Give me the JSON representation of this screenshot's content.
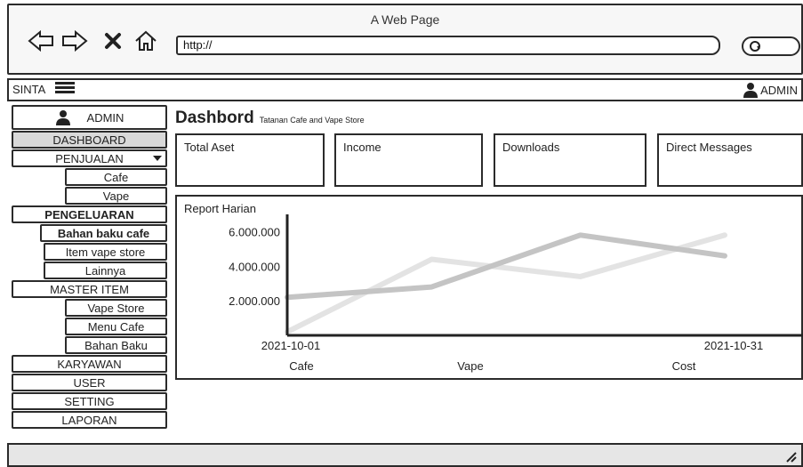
{
  "window": {
    "title": "A Web Page"
  },
  "browser": {
    "url": "http://"
  },
  "app_bar": {
    "brand": "SINTA",
    "user": "ADMIN"
  },
  "sidebar": {
    "user": "ADMIN",
    "items": [
      {
        "label": "DASHBOARD"
      },
      {
        "label": "PENJUALAN"
      },
      {
        "label": "Cafe"
      },
      {
        "label": "Vape"
      },
      {
        "label": "PENGELUARAN"
      },
      {
        "label": "Bahan baku cafe"
      },
      {
        "label": "Item vape store"
      },
      {
        "label": "Lainnya"
      },
      {
        "label": "MASTER ITEM"
      },
      {
        "label": "Vape Store"
      },
      {
        "label": "Menu Cafe"
      },
      {
        "label": "Bahan Baku"
      },
      {
        "label": "KARYAWAN"
      },
      {
        "label": "USER"
      },
      {
        "label": "SETTING"
      },
      {
        "label": "LAPORAN"
      }
    ]
  },
  "main": {
    "title": "Dashbord",
    "subtitle": "Tatanan Cafe and Vape Store",
    "cards": [
      {
        "label": "Total Aset"
      },
      {
        "label": "Income"
      },
      {
        "label": "Downloads"
      },
      {
        "label": "Direct Messages"
      }
    ]
  },
  "chart_data": {
    "type": "line",
    "title": "Report Harian",
    "x": [
      "2021-10-01",
      "2021-10-31"
    ],
    "yticks": [
      "2.000.000",
      "4.000.000",
      "6.000.000"
    ],
    "ylim": [
      0,
      7000000
    ],
    "series": [
      {
        "name": "Cafe",
        "color": "#c4c4c4",
        "values": [
          [
            0,
            2200000
          ],
          [
            0.33,
            2800000
          ],
          [
            0.67,
            5800000
          ],
          [
            1.0,
            4600000
          ]
        ]
      },
      {
        "name": "Vape",
        "color": "#e3e3e3",
        "values": [
          [
            0,
            200000
          ],
          [
            0.33,
            4400000
          ],
          [
            0.67,
            3400000
          ],
          [
            1.0,
            5800000
          ]
        ]
      }
    ],
    "legend": [
      "Cafe",
      "Vape",
      "Cost"
    ],
    "legend_position": "bottom"
  },
  "colors": {
    "active": "#d9d9d9",
    "border": "#2b2b2b",
    "status": "#e6e6e6"
  }
}
